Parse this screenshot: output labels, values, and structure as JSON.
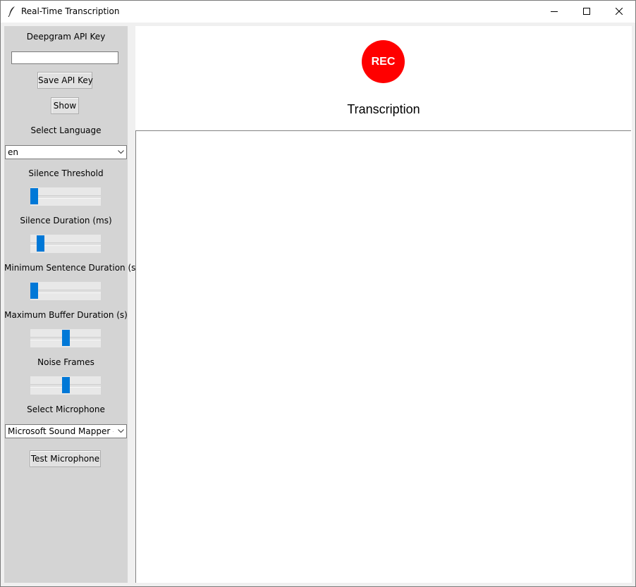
{
  "window": {
    "title": "Real-Time Transcription",
    "icon": "feather-icon"
  },
  "sidebar": {
    "api_key_label": "Deepgram API Key",
    "api_key_value": "",
    "save_api_key_label": "Save API Key",
    "show_label": "Show",
    "language_label": "Select Language",
    "language_value": "en",
    "silence_threshold_label": "Silence Threshold",
    "silence_threshold_level": 0.0,
    "silence_duration_label": "Silence Duration (ms)",
    "silence_duration_level": 0.1,
    "min_sentence_label": "Minimum Sentence Duration (s)",
    "min_sentence_level": 0.0,
    "max_buffer_label": "Maximum Buffer Duration (s)",
    "max_buffer_level": 0.5,
    "noise_frames_label": "Noise Frames",
    "noise_frames_level": 0.51,
    "microphone_label": "Select Microphone",
    "microphone_value": "Microsoft Sound Mapper - Ir",
    "test_microphone_label": "Test Microphone"
  },
  "main": {
    "rec_label": "REC",
    "rec_color": "#ff0000",
    "transcription_title": "Transcription",
    "transcription_text": ""
  },
  "colors": {
    "accent": "#0078d7",
    "sidebar_bg": "#d4d4d4"
  }
}
